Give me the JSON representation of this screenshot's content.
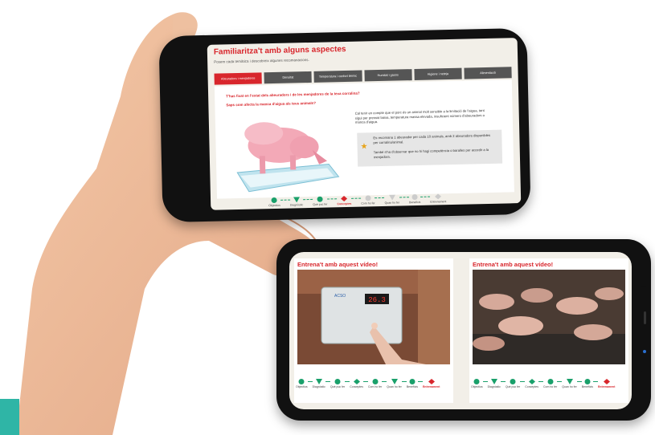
{
  "screen1": {
    "title": "Familiaritza't amb alguns aspectes",
    "subtitle": "Posem cada temàtica i descobreix algunes recomanacions.",
    "tabs": [
      {
        "label": "Abeuradors i menjadores",
        "active": true
      },
      {
        "label": "Densitat",
        "active": false
      },
      {
        "label": "Temperatura i confort tèrmic",
        "active": false
      },
      {
        "label": "Humitat i gasos",
        "active": false
      },
      {
        "label": "Higiene i neteja",
        "active": false
      },
      {
        "label": "Alimentació",
        "active": false
      }
    ],
    "question1": "T'has fixat en l'estat dels abeuradors i de les menjadores de la teva corralina?",
    "question2": "Saps com afecta la manca d'aigua als teus animals?",
    "paragraph": "Cal tenir en compte que el porc és un animal molt sensible a la limitació de l'aigua, tant sigui per pressió baixa, temperatura massa elevada, insuficient número d'abeuradors o manca d'aigua.",
    "tip_part1": "Es recomana 1 abeurador per cada 10 animals, amb 2 abeuradors disponibles per corralina/animal.",
    "tip_part2": "També s'ha d'observar que no hi hagi competència o baralles per accedir a la menjadora.",
    "progress": [
      "Objectius",
      "Diagnòstic",
      "Què puc fer",
      "Conceptes",
      "Com ho fer",
      "Quan ho fer",
      "Beneficis",
      "Entrenament"
    ],
    "progress_active_index": 3
  },
  "screen2": {
    "card_title": "Entrena't amb aquest vídeo!",
    "display_value": "26.3",
    "device_label": "ACSO",
    "progress": [
      "Objectius",
      "Diagnòstic",
      "Què puc fer",
      "Conceptes",
      "Com ho fer",
      "Quan ho fer",
      "Beneficis",
      "Entrenament"
    ],
    "progress_active_index": 7
  },
  "colors": {
    "accent_red": "#d8262c",
    "tab_gray": "#555555",
    "progress_green": "#1aa06b",
    "teal": "#2fb5a6"
  }
}
